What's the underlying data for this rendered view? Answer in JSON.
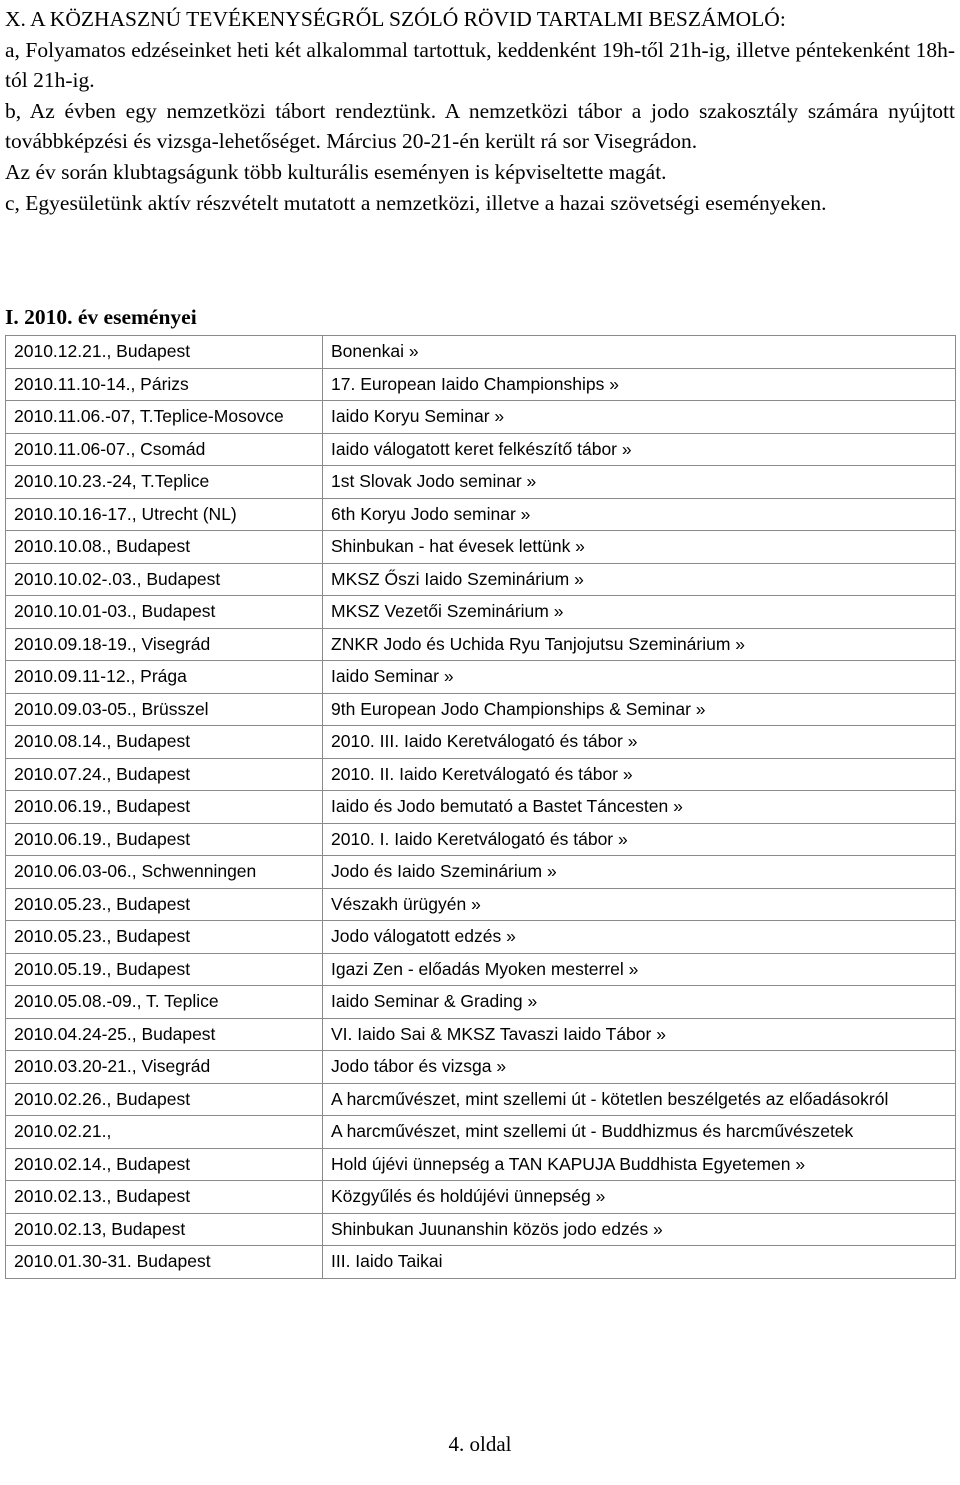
{
  "document": {
    "heading": "X. A KÖZHASZNÚ TEVÉKENYSÉGRŐL SZÓLÓ RÖVID TARTALMI BESZÁMOLÓ:",
    "paragraphs": [
      "a, Folyamatos edzéseinket heti két alkalommal tartottuk, keddenként 19h-től 21h-ig, illetve péntekenként 18h-tól 21h-ig.",
      "b, Az évben egy nemzetközi tábort rendeztünk. A nemzetközi tábor a jodo szakosztály számára nyújtott továbbképzési és vizsga-lehetőséget. Március 20-21-én került rá sor Visegrádon.",
      "Az év során klubtagságunk több kulturális eseményen is képviseltette magát.",
      "c, Egyesületünk aktív részvételt mutatott a nemzetközi, illetve a hazai szövetségi eseményeken."
    ],
    "section_heading": "I. 2010. év eseményei",
    "footer": "4. oldal"
  },
  "events_table": {
    "rows": [
      {
        "date": "2010.12.21., Budapest",
        "event": "Bonenkai »"
      },
      {
        "date": "2010.11.10-14., Párizs",
        "event": "17. European Iaido Championships »"
      },
      {
        "date": "2010.11.06.-07, T.Teplice-Mosovce",
        "event": "Iaido Koryu Seminar »"
      },
      {
        "date": "2010.11.06-07., Csomád",
        "event": "Iaido válogatott keret felkészítő tábor »"
      },
      {
        "date": "2010.10.23.-24, T.Teplice",
        "event": "1st Slovak Jodo seminar »"
      },
      {
        "date": "2010.10.16-17., Utrecht (NL)",
        "event": "6th Koryu Jodo seminar »"
      },
      {
        "date": "2010.10.08., Budapest",
        "event": "Shinbukan - hat évesek lettünk »"
      },
      {
        "date": "2010.10.02-.03., Budapest",
        "event": "MKSZ Őszi Iaido Szeminárium »"
      },
      {
        "date": "2010.10.01-03., Budapest",
        "event": "MKSZ Vezetői Szeminárium »"
      },
      {
        "date": "2010.09.18-19., Visegrád",
        "event": "ZNKR Jodo és Uchida Ryu Tanjojutsu Szeminárium »"
      },
      {
        "date": "2010.09.11-12., Prága",
        "event": "Iaido Seminar »"
      },
      {
        "date": "2010.09.03-05., Brüsszel",
        "event": "9th European Jodo Championships & Seminar »"
      },
      {
        "date": "2010.08.14., Budapest",
        "event": "2010. III. Iaido Keretválogató és tábor »"
      },
      {
        "date": "2010.07.24., Budapest",
        "event": "2010. II. Iaido Keretválogató és tábor »"
      },
      {
        "date": "2010.06.19., Budapest",
        "event": "Iaido és Jodo bemutató a Bastet Táncesten »"
      },
      {
        "date": "2010.06.19., Budapest",
        "event": "2010. I. Iaido Keretválogató és tábor »"
      },
      {
        "date": "2010.06.03-06., Schwenningen",
        "event": "Jodo és Iaido Szeminárium »"
      },
      {
        "date": "2010.05.23., Budapest",
        "event": "Vészakh ürügyén »"
      },
      {
        "date": "2010.05.23., Budapest",
        "event": "Jodo válogatott edzés »"
      },
      {
        "date": "2010.05.19., Budapest",
        "event": "Igazi Zen - előadás Myoken mesterrel »"
      },
      {
        "date": "2010.05.08.-09., T. Teplice",
        "event": "Iaido Seminar & Grading »"
      },
      {
        "date": "2010.04.24-25., Budapest",
        "event": "VI. Iaido Sai & MKSZ Tavaszi Iaido Tábor »"
      },
      {
        "date": "2010.03.20-21., Visegrád",
        "event": "Jodo tábor és vizsga »"
      },
      {
        "date": "2010.02.26., Budapest",
        "event": "A harcművészet, mint szellemi út - kötetlen beszélgetés az előadásokról"
      },
      {
        "date": "2010.02.21.,",
        "event": "A harcművészet, mint szellemi út - Buddhizmus és harcművészetek"
      },
      {
        "date": "2010.02.14., Budapest",
        "event": "Hold újévi ünnepség a TAN KAPUJA Buddhista Egyetemen »"
      },
      {
        "date": "2010.02.13., Budapest",
        "event": "Közgyűlés és holdújévi ünnepség »"
      },
      {
        "date": "2010.02.13, Budapest",
        "event": "Shinbukan Juunanshin közös jodo edzés »"
      },
      {
        "date": "2010.01.30-31. Budapest",
        "event": "III. Iaido Taikai"
      }
    ]
  }
}
